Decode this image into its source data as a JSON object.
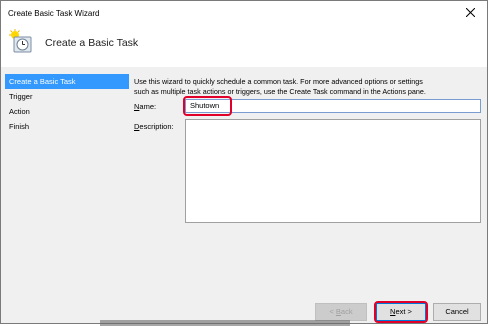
{
  "window": {
    "title": "Create Basic Task Wizard"
  },
  "header": {
    "title": "Create a Basic Task",
    "icon": "task-clock-icon"
  },
  "nav": {
    "items": [
      {
        "label": "Create a Basic Task",
        "active": true
      },
      {
        "label": "Trigger"
      },
      {
        "label": "Action"
      },
      {
        "label": "Finish"
      }
    ]
  },
  "content": {
    "intro_line1": "Use this wizard to quickly schedule a common task.  For more advanced options or settings",
    "intro_line2": "such as multiple task actions or triggers, use the Create Task command in the Actions pane.",
    "name_label_pre": "N",
    "name_label_post": "ame:",
    "name_value": "Shutown",
    "desc_label_pre": "D",
    "desc_label_post": "escription:",
    "desc_value": ""
  },
  "buttons": {
    "back_pre": "< ",
    "back_u": "B",
    "back_post": "ack",
    "next_u": "N",
    "next_post": "ext >",
    "cancel": "Cancel"
  },
  "colors": {
    "accent": "#3399ff",
    "annotation": "#e0002a"
  }
}
